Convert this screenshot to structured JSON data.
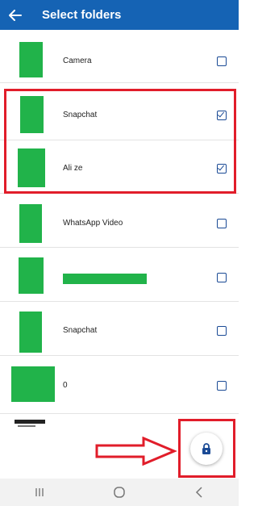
{
  "header": {
    "title": "Select folders",
    "back_icon": "arrow-left-icon"
  },
  "folders": [
    {
      "label": "Camera",
      "checked": false
    },
    {
      "label": "Snapchat",
      "checked": true
    },
    {
      "label": "Ali ze",
      "checked": true
    },
    {
      "label": "WhatsApp Video",
      "checked": false
    },
    {
      "label": "",
      "checked": false,
      "redacted": true
    },
    {
      "label": "Snapchat",
      "checked": false
    },
    {
      "label": "0",
      "checked": false
    }
  ],
  "fab": {
    "icon": "lock-icon"
  },
  "navbar": {
    "icons": [
      "recent-apps-icon",
      "home-icon",
      "back-icon"
    ]
  },
  "colors": {
    "appbar": "#1563b4",
    "thumbnail": "#21b34a",
    "checkbox": "#1a4a95",
    "annotation": "#e11d2a"
  }
}
